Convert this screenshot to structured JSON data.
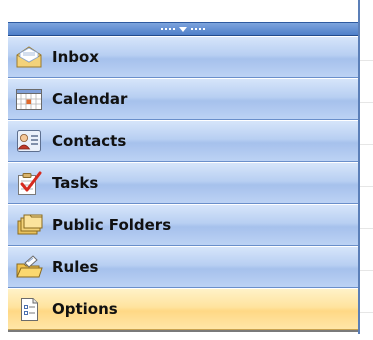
{
  "pane": {
    "splitter_icon": "chevron-down-icon",
    "items": [
      {
        "label": "Inbox",
        "icon": "inbox-icon",
        "selected": false
      },
      {
        "label": "Calendar",
        "icon": "calendar-icon",
        "selected": false
      },
      {
        "label": "Contacts",
        "icon": "contacts-icon",
        "selected": false
      },
      {
        "label": "Tasks",
        "icon": "tasks-icon",
        "selected": false
      },
      {
        "label": "Public Folders",
        "icon": "public-folders-icon",
        "selected": false
      },
      {
        "label": "Rules",
        "icon": "rules-icon",
        "selected": false
      },
      {
        "label": "Options",
        "icon": "options-icon",
        "selected": true
      }
    ]
  },
  "colors": {
    "button_blue": "#b8cff2",
    "selected_gold": "#ffe39e",
    "splitter_blue": "#4f7fc9"
  }
}
